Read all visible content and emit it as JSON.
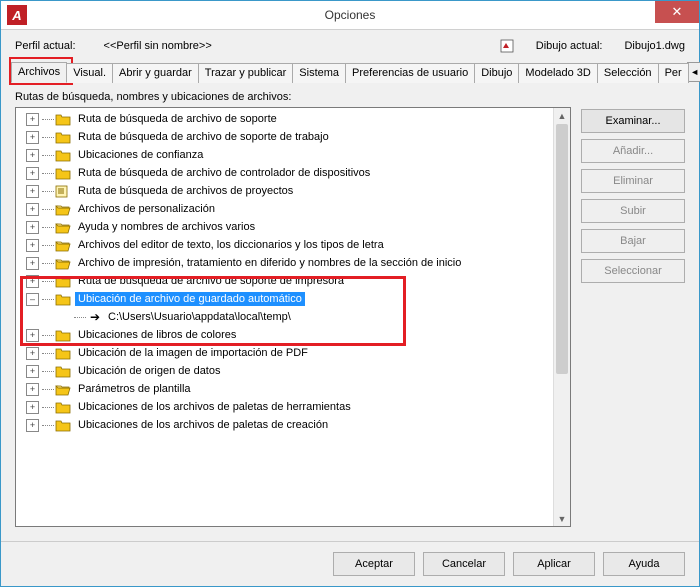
{
  "window": {
    "title": "Opciones",
    "app_icon_text": "A"
  },
  "profile": {
    "label": "Perfil actual:",
    "value": "<<Perfil sin nombre>>",
    "drawing_label": "Dibujo actual:",
    "drawing_value": "Dibujo1.dwg"
  },
  "tabs": {
    "items": [
      {
        "label": "Archivos",
        "active": true
      },
      {
        "label": "Visual."
      },
      {
        "label": "Abrir y guardar"
      },
      {
        "label": "Trazar y publicar"
      },
      {
        "label": "Sistema"
      },
      {
        "label": "Preferencias de usuario"
      },
      {
        "label": "Dibujo"
      },
      {
        "label": "Modelado 3D"
      },
      {
        "label": "Selección"
      },
      {
        "label": "Per"
      }
    ],
    "scroll_left": "◄",
    "scroll_right": "►"
  },
  "tree": {
    "title": "Rutas de búsqueda, nombres y ubicaciones de archivos:",
    "items": [
      {
        "label": "Ruta de búsqueda de archivo de soporte",
        "icon": "folder",
        "exp": "+"
      },
      {
        "label": "Ruta de búsqueda de archivo de soporte de trabajo",
        "icon": "folder",
        "exp": "+"
      },
      {
        "label": "Ubicaciones de confianza",
        "icon": "folder",
        "exp": "+"
      },
      {
        "label": "Ruta de búsqueda de archivo de controlador de dispositivos",
        "icon": "folder",
        "exp": "+"
      },
      {
        "label": "Ruta de búsqueda de archivos de proyectos",
        "icon": "project",
        "exp": "+"
      },
      {
        "label": "Archivos de personalización",
        "icon": "folder-open",
        "exp": "+"
      },
      {
        "label": "Ayuda y nombres de archivos varios",
        "icon": "folder-open",
        "exp": "+"
      },
      {
        "label": "Archivos del editor de texto, los diccionarios y los tipos de letra",
        "icon": "folder-open",
        "exp": "+"
      },
      {
        "label": "Archivo de impresión, tratamiento en diferido y nombres de la sección de inicio",
        "icon": "folder-open",
        "exp": "+"
      },
      {
        "label": "Ruta de búsqueda de archivo de soporte de impresora",
        "icon": "folder",
        "exp": "+"
      },
      {
        "label": "Ubicación de archivo de guardado automático",
        "icon": "folder",
        "exp": "–",
        "sel": true,
        "children": [
          {
            "label": "C:\\Users\\Usuario\\appdata\\local\\temp\\",
            "icon": "arrow"
          }
        ]
      },
      {
        "label": "Ubicaciones de libros de colores",
        "icon": "folder",
        "exp": "+"
      },
      {
        "label": "Ubicación de la imagen de importación de PDF",
        "icon": "folder",
        "exp": "+"
      },
      {
        "label": "Ubicación de origen de datos",
        "icon": "folder",
        "exp": "+"
      },
      {
        "label": "Parámetros de plantilla",
        "icon": "folder-open",
        "exp": "+"
      },
      {
        "label": "Ubicaciones de los archivos de paletas de herramientas",
        "icon": "folder",
        "exp": "+"
      },
      {
        "label": "Ubicaciones de los archivos de paletas de creación",
        "icon": "folder",
        "exp": "+"
      }
    ]
  },
  "side_buttons": [
    {
      "label": "Examinar...",
      "enabled": true
    },
    {
      "label": "Añadir...",
      "enabled": false
    },
    {
      "label": "Eliminar",
      "enabled": false
    },
    {
      "label": "Subir",
      "enabled": false
    },
    {
      "label": "Bajar",
      "enabled": false
    },
    {
      "label": "Seleccionar",
      "enabled": false
    }
  ],
  "footer": {
    "ok": "Aceptar",
    "cancel": "Cancelar",
    "apply": "Aplicar",
    "help": "Ayuda"
  }
}
